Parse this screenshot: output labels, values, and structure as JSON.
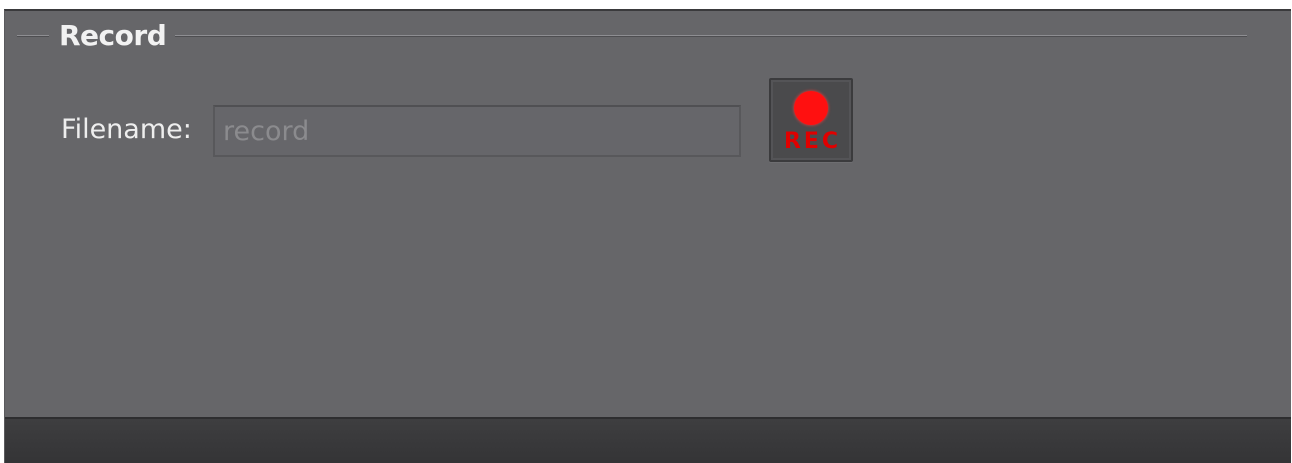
{
  "group": {
    "title": "Record"
  },
  "filename": {
    "label": "Filename:",
    "value": "",
    "placeholder": "record"
  },
  "rec_button": {
    "label": "REC",
    "dot_color": "#ff1010",
    "text_color": "#e00000"
  },
  "colors": {
    "panel_background": "#666669",
    "footer_background": "#3a3a3c"
  }
}
